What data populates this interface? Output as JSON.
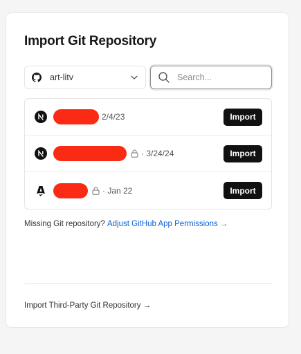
{
  "page": {
    "title": "Import Git Repository"
  },
  "scope": {
    "account": "art-litv",
    "icon": "github-icon"
  },
  "search": {
    "placeholder": "Search..."
  },
  "repositories": [
    {
      "framework_icon": "nextjs-icon",
      "private": false,
      "meta": "2/4/23",
      "import_label": "Import"
    },
    {
      "framework_icon": "nextjs-icon",
      "private": true,
      "meta": "· 3/24/24",
      "import_label": "Import"
    },
    {
      "framework_icon": "astro-icon",
      "private": true,
      "meta": "· Jan 22",
      "import_label": "Import"
    }
  ],
  "footer": {
    "missing_text": "Missing Git repository?",
    "adjust_link": "Adjust GitHub App Permissions →",
    "third_party_link": "Import Third-Party Git Repository →"
  },
  "colors": {
    "redaction": "#fa2a14",
    "link": "#0a62d6",
    "button": "#111111"
  }
}
